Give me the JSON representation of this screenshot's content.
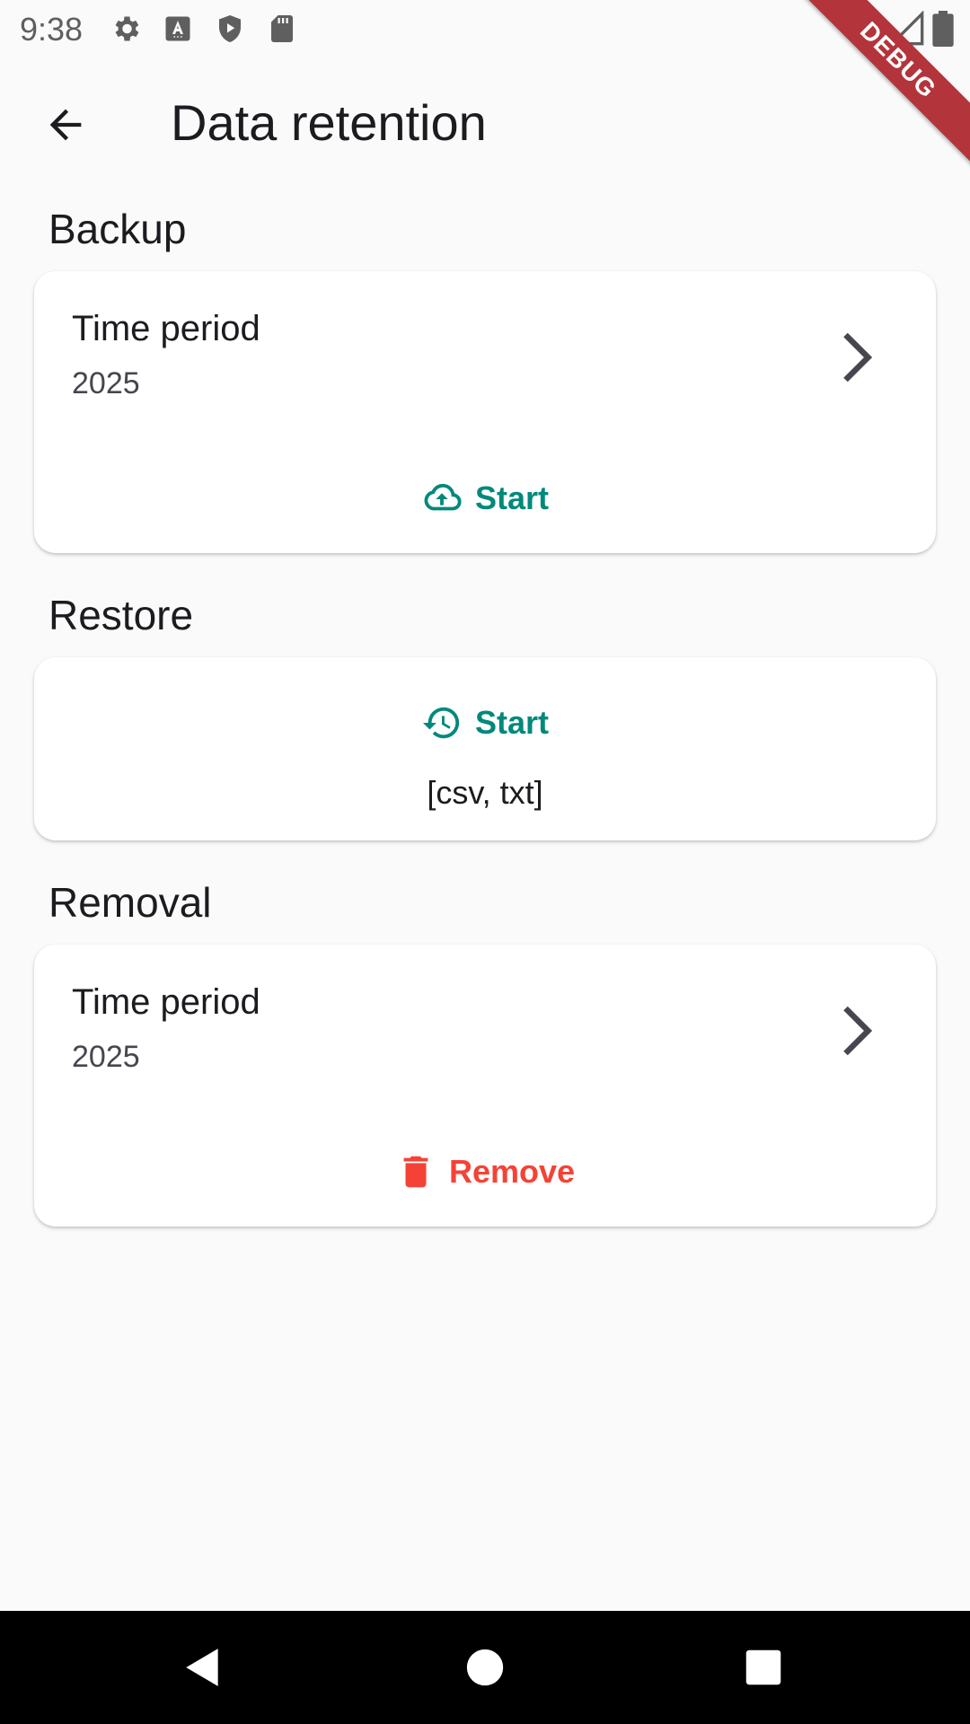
{
  "status_bar": {
    "time": "9:38",
    "icons": [
      "gear-icon",
      "a-keyboard-icon",
      "shield-play-icon",
      "sd-card-icon",
      "wifi-icon",
      "signal-icon",
      "battery-icon"
    ]
  },
  "debug_banner": "DEBUG",
  "app_bar": {
    "title": "Data retention",
    "back_icon": "arrow-back-icon"
  },
  "backup": {
    "section_title": "Backup",
    "tile_title": "Time period",
    "tile_value": "2025",
    "action_label": "Start",
    "action_icon": "cloud-upload-icon"
  },
  "restore": {
    "section_title": "Restore",
    "action_label": "Start",
    "action_icon": "history-icon",
    "formats": "[csv, txt]"
  },
  "removal": {
    "section_title": "Removal",
    "tile_title": "Time period",
    "tile_value": "2025",
    "action_label": "Remove",
    "action_icon": "trash-icon"
  },
  "colors": {
    "accent": "#00897b",
    "danger": "#f44336",
    "background": "#fafafa",
    "card": "#ffffff"
  },
  "nav_bar": {
    "icons": [
      "back-triangle-icon",
      "home-circle-icon",
      "recents-square-icon"
    ]
  }
}
